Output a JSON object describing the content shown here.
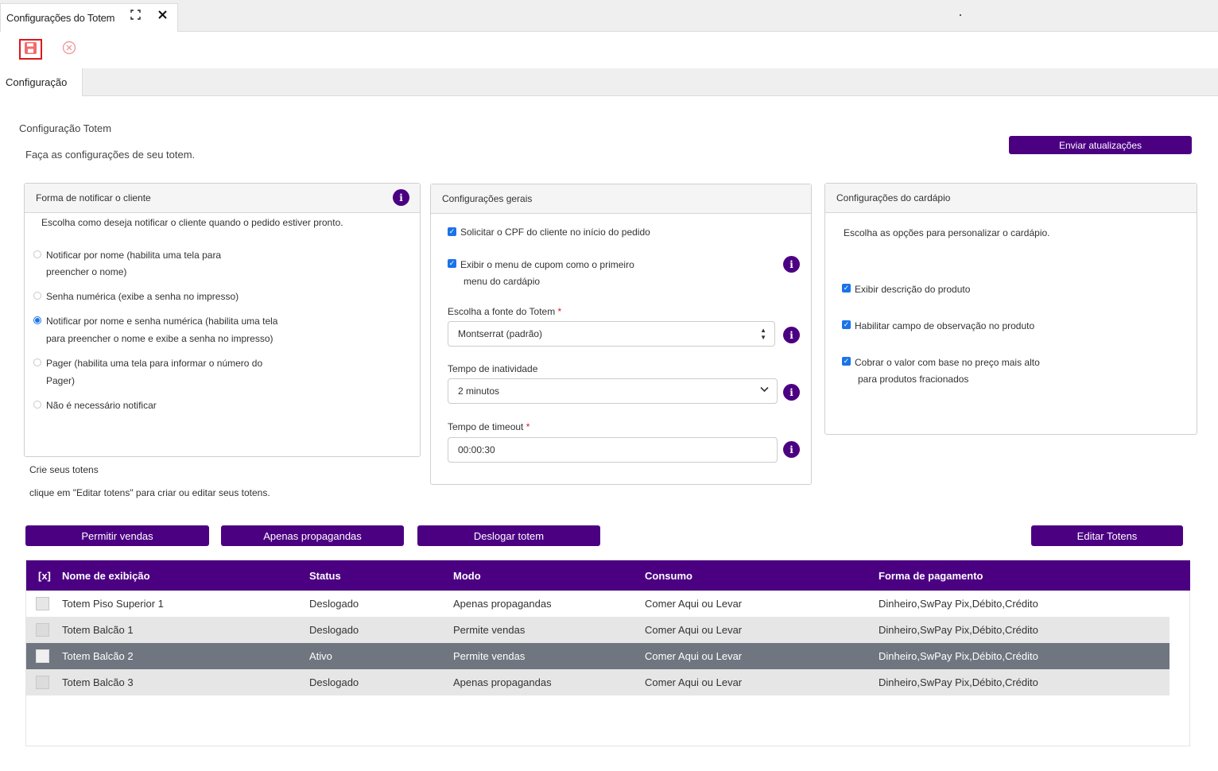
{
  "window": {
    "tab_title": "Configurações do Totem"
  },
  "subtab": "Configuração",
  "page": {
    "title": "Configuração Totem",
    "subtitle": "Faça as configurações de seu totem.",
    "send_updates_label": "Enviar atualizações"
  },
  "notify_card": {
    "header": "Forma de notificar o cliente",
    "intro": "Escolha como deseja notificar o cliente quando o pedido estiver pronto.",
    "options": [
      {
        "line1": "Notificar por nome (habilita uma tela para",
        "line2": "preencher o nome)",
        "selected": false
      },
      {
        "line1": "Senha numérica (exibe a senha no impresso)",
        "line2": "",
        "selected": false
      },
      {
        "line1": "Notificar por nome e senha numérica (habilita uma tela",
        "line2": "para preencher o nome e exibe a senha no impresso)",
        "selected": true
      },
      {
        "line1": "Pager (habilita uma tela para informar o número do",
        "line2": "Pager)",
        "selected": false
      },
      {
        "line1": "Não é necessário notificar",
        "line2": "",
        "selected": false
      }
    ]
  },
  "general_card": {
    "header": "Configurações gerais",
    "cpf_label": "Solicitar o CPF do cliente no início do pedido",
    "coupon_line1": "Exibir o menu de cupom como o primeiro",
    "coupon_line2": "menu do cardápio",
    "font_label": "Escolha a fonte do Totem",
    "font_value": "Montserrat (padrão)",
    "inactivity_label": "Tempo de inatividade",
    "inactivity_value": "2 minutos",
    "timeout_label": "Tempo de timeout",
    "timeout_value": "00:00:30",
    "required_mark": "*"
  },
  "menu_card": {
    "header": "Configurações do cardápio",
    "intro": "Escolha as opções para personalizar o cardápio.",
    "opt1": "Exibir descrição do produto",
    "opt2": "Habilitar campo de observação no produto",
    "opt3_line1": "Cobrar o valor com base no preço mais alto",
    "opt3_line2": "para produtos fracionados"
  },
  "totems": {
    "title": "Crie seus totens",
    "hint": "clique em \"Editar totens\" para criar ou editar seus totens.",
    "buttons": {
      "allow_sales": "Permitir vendas",
      "ads_only": "Apenas propagandas",
      "logout": "Deslogar totem",
      "edit": "Editar Totens"
    },
    "columns": {
      "select_all": "[x]",
      "name": "Nome de exibição",
      "status": "Status",
      "mode": "Modo",
      "consumption": "Consumo",
      "payment": "Forma de pagamento"
    },
    "rows": [
      {
        "name": "Totem Piso Superior 1",
        "status": "Deslogado",
        "mode": "Apenas propagandas",
        "consumption": "Comer Aqui ou Levar",
        "payment": "Dinheiro,SwPay Pix,Débito,Crédito"
      },
      {
        "name": "Totem Balcão 1",
        "status": "Deslogado",
        "mode": "Permite vendas",
        "consumption": "Comer Aqui ou Levar",
        "payment": "Dinheiro,SwPay Pix,Débito,Crédito"
      },
      {
        "name": "Totem Balcão 2",
        "status": "Ativo",
        "mode": "Permite vendas",
        "consumption": "Comer Aqui ou Levar",
        "payment": "Dinheiro,SwPay Pix,Débito,Crédito"
      },
      {
        "name": "Totem Balcão 3",
        "status": "Deslogado",
        "mode": "Apenas propagandas",
        "consumption": "Comer Aqui ou Levar",
        "payment": "Dinheiro,SwPay Pix,Débito,Crédito"
      }
    ]
  },
  "colors": {
    "accent": "#4b0082",
    "selected_row": "#6f7680",
    "danger": "#e0161d"
  }
}
